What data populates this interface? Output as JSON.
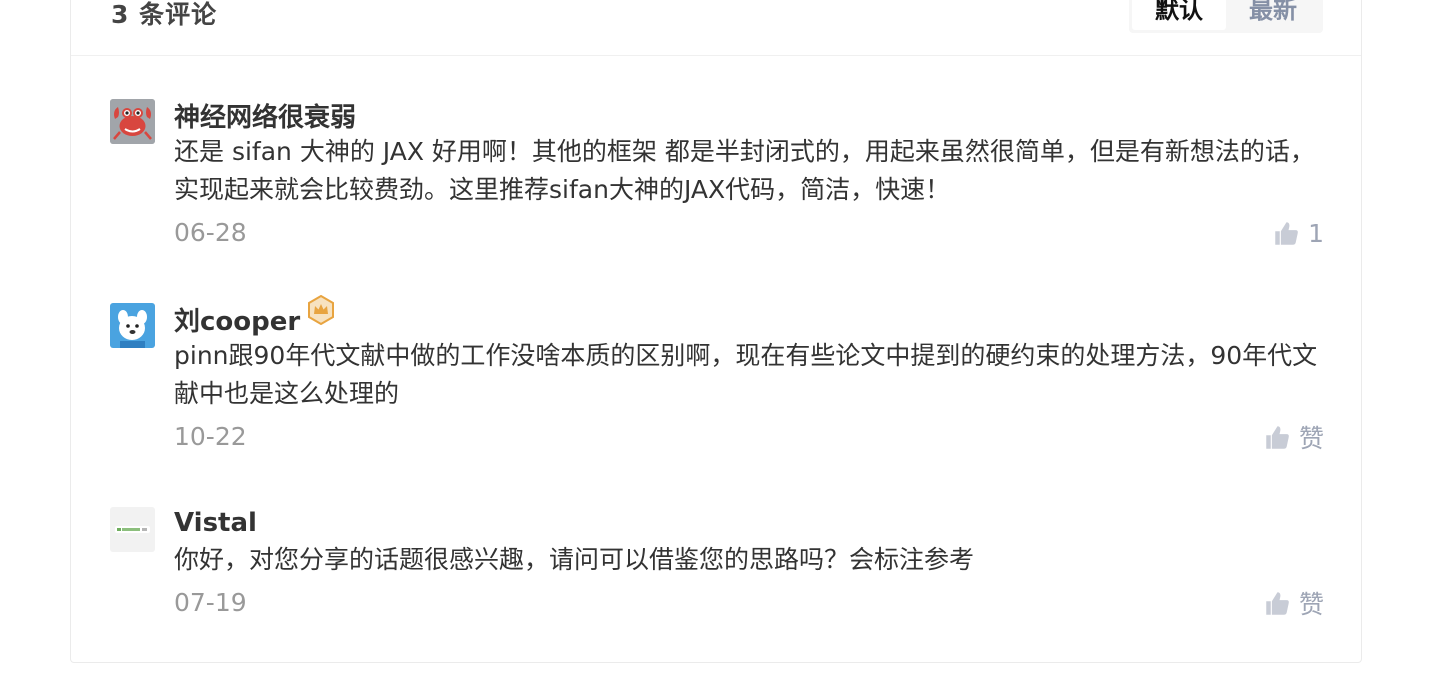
{
  "header": {
    "count_title": "3 条评论",
    "sort_default": "默认",
    "sort_latest": "最新"
  },
  "comments": [
    {
      "author": "神经网络很衰弱",
      "text": "还是 sifan 大神的 JAX 好用啊！其他的框架 都是半封闭式的，用起来虽然很简单，但是有新想法的话，实现起来就会比较费劲。这里推荐sifan大神的JAX代码，简洁，快速！",
      "time": "06-28",
      "like_label": "1",
      "avatar_icon": "crab-avatar-icon"
    },
    {
      "author": "刘cooper",
      "text": "pinn跟90年代文献中做的工作没啥本质的区别啊，现在有些论文中提到的硬约束的处理方法，90年代文献中也是这么处理的",
      "time": "10-22",
      "like_label": "赞",
      "avatar_icon": "cartoon-dog-avatar-icon",
      "badge_icon": "crown-badge-icon"
    },
    {
      "author": "Vistal",
      "text": "你好，对您分享的话题很感兴趣，请问可以借鉴您的思路吗？会标注参考",
      "time": "07-19",
      "like_label": "赞",
      "avatar_icon": "logo-avatar-icon"
    }
  ],
  "colors": {
    "like_icon": "#c8ccd6",
    "muted_text": "#999999",
    "badge": "#e8a440"
  }
}
